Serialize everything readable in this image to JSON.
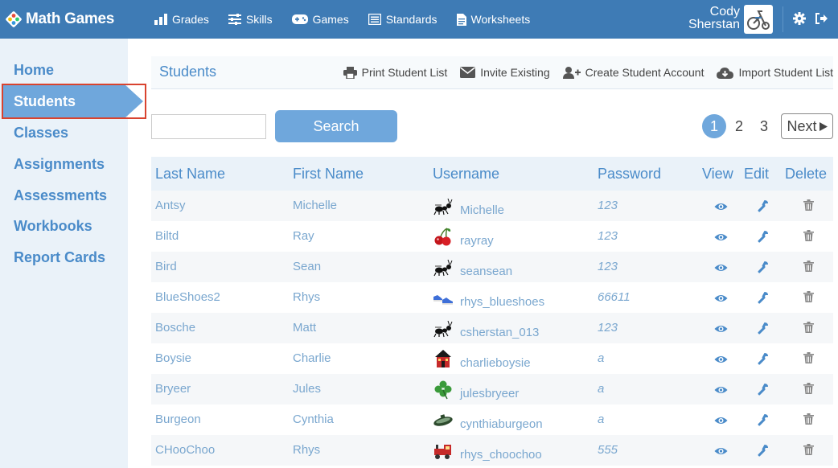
{
  "brand": {
    "name": "Math Games"
  },
  "nav": [
    {
      "label": "Grades",
      "icon": "bar-chart-icon"
    },
    {
      "label": "Skills",
      "icon": "sliders-icon"
    },
    {
      "label": "Games",
      "icon": "gamepad-icon"
    },
    {
      "label": "Standards",
      "icon": "list-icon"
    },
    {
      "label": "Worksheets",
      "icon": "document-icon"
    }
  ],
  "user": {
    "first": "Cody",
    "last": "Sherstan",
    "avatar": "tricycle-icon"
  },
  "sidebar": {
    "items": [
      {
        "label": "Home"
      },
      {
        "label": "Students",
        "active": true
      },
      {
        "label": "Classes"
      },
      {
        "label": "Assignments"
      },
      {
        "label": "Assessments"
      },
      {
        "label": "Workbooks"
      },
      {
        "label": "Report Cards"
      }
    ]
  },
  "page": {
    "title": "Students"
  },
  "actions": [
    {
      "label": "Print Student List",
      "icon": "printer-icon"
    },
    {
      "label": "Invite Existing",
      "icon": "envelope-icon"
    },
    {
      "label": "Create Student Account",
      "icon": "user-plus-icon"
    },
    {
      "label": "Import Student List",
      "icon": "cloud-download-icon"
    }
  ],
  "search": {
    "value": "",
    "button": "Search"
  },
  "pagination": {
    "pages": [
      "1",
      "2",
      "3"
    ],
    "current": "1",
    "next": "Next"
  },
  "table": {
    "columns": [
      "Last Name",
      "First Name",
      "Username",
      "Password",
      "View",
      "Edit",
      "Delete"
    ],
    "rows": [
      {
        "last": "Antsy",
        "first": "Michelle",
        "username": "Michelle",
        "password": "123",
        "avatar": "ant"
      },
      {
        "last": "Biltd",
        "first": "Ray",
        "username": "rayray",
        "password": "123",
        "avatar": "cherries"
      },
      {
        "last": "Bird",
        "first": "Sean",
        "username": "seansean",
        "password": "123",
        "avatar": "ant"
      },
      {
        "last": "BlueShoes2",
        "first": "Rhys",
        "username": "rhys_blueshoes",
        "password": "66611",
        "avatar": "shoes"
      },
      {
        "last": "Bosche",
        "first": "Matt",
        "username": "csherstan_013",
        "password": "123",
        "avatar": "ant"
      },
      {
        "last": "Boysie",
        "first": "Charlie",
        "username": "charlieboysie",
        "password": "a",
        "avatar": "house"
      },
      {
        "last": "Bryeer",
        "first": "Jules",
        "username": "julesbryeer",
        "password": "a",
        "avatar": "clover"
      },
      {
        "last": "Burgeon",
        "first": "Cynthia",
        "username": "cynthiaburgeon",
        "password": "a",
        "avatar": "submarine"
      },
      {
        "last": "CHooChoo",
        "first": "Rhys",
        "username": "rhys_choochoo",
        "password": "555",
        "avatar": "train"
      }
    ]
  },
  "colors": {
    "topbar": "#3e7bb5",
    "accent": "#6fa7dc",
    "sidebar": "#eaf2f9",
    "highlight": "#d9432f"
  }
}
